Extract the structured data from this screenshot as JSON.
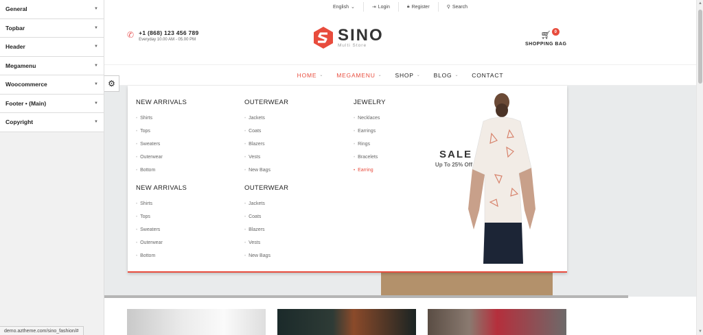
{
  "panel": {
    "items": [
      {
        "label": "General"
      },
      {
        "label": "Topbar"
      },
      {
        "label": "Header"
      },
      {
        "label": "Megamenu"
      },
      {
        "label": "Woocommerce"
      },
      {
        "label": "Footer • (Main)"
      },
      {
        "label": "Copyright"
      }
    ]
  },
  "topbar": {
    "language": "English",
    "login": "Login",
    "register": "Register",
    "search": "Search"
  },
  "header": {
    "phone": "+1 (868) 123 456 789",
    "hours": "Everyday 10.00 AM - 05.00 PM",
    "logo_text": "SINO",
    "logo_sub": "Multi Store",
    "bag_label": "SHOPPING BAG",
    "bag_count": "0"
  },
  "nav": {
    "items": [
      {
        "label": "HOME"
      },
      {
        "label": "MEGAMENU"
      },
      {
        "label": "SHOP"
      },
      {
        "label": "BLOG"
      },
      {
        "label": "CONTACT"
      }
    ]
  },
  "mega": {
    "columns": [
      {
        "title": "NEW ARRIVALS",
        "items": [
          "Shirts",
          "Tops",
          "Sweaters",
          "Outerwear",
          "Bottom"
        ]
      },
      {
        "title": "OUTERWEAR",
        "items": [
          "Jackets",
          "Coats",
          "Blazers",
          "Vests",
          "New Bags"
        ]
      },
      {
        "title": "JEWELRY",
        "items": [
          "Necklaces",
          "Earrings",
          "Rings",
          "Bracelets",
          "Earring"
        ]
      },
      {
        "title": "NEW ARRIVALS",
        "items": [
          "Shirts",
          "Tops",
          "Sweaters",
          "Outerwear",
          "Bottom"
        ]
      },
      {
        "title": "OUTERWEAR",
        "items": [
          "Jackets",
          "Coats",
          "Blazers",
          "Vests",
          "New Bags"
        ]
      }
    ],
    "sale_title": "SALE",
    "sale_sub": "Up To 25% Off"
  },
  "status": {
    "url": "demo.aztheme.com/sino_fashion/#"
  },
  "colors": {
    "accent": "#e84c3d"
  }
}
